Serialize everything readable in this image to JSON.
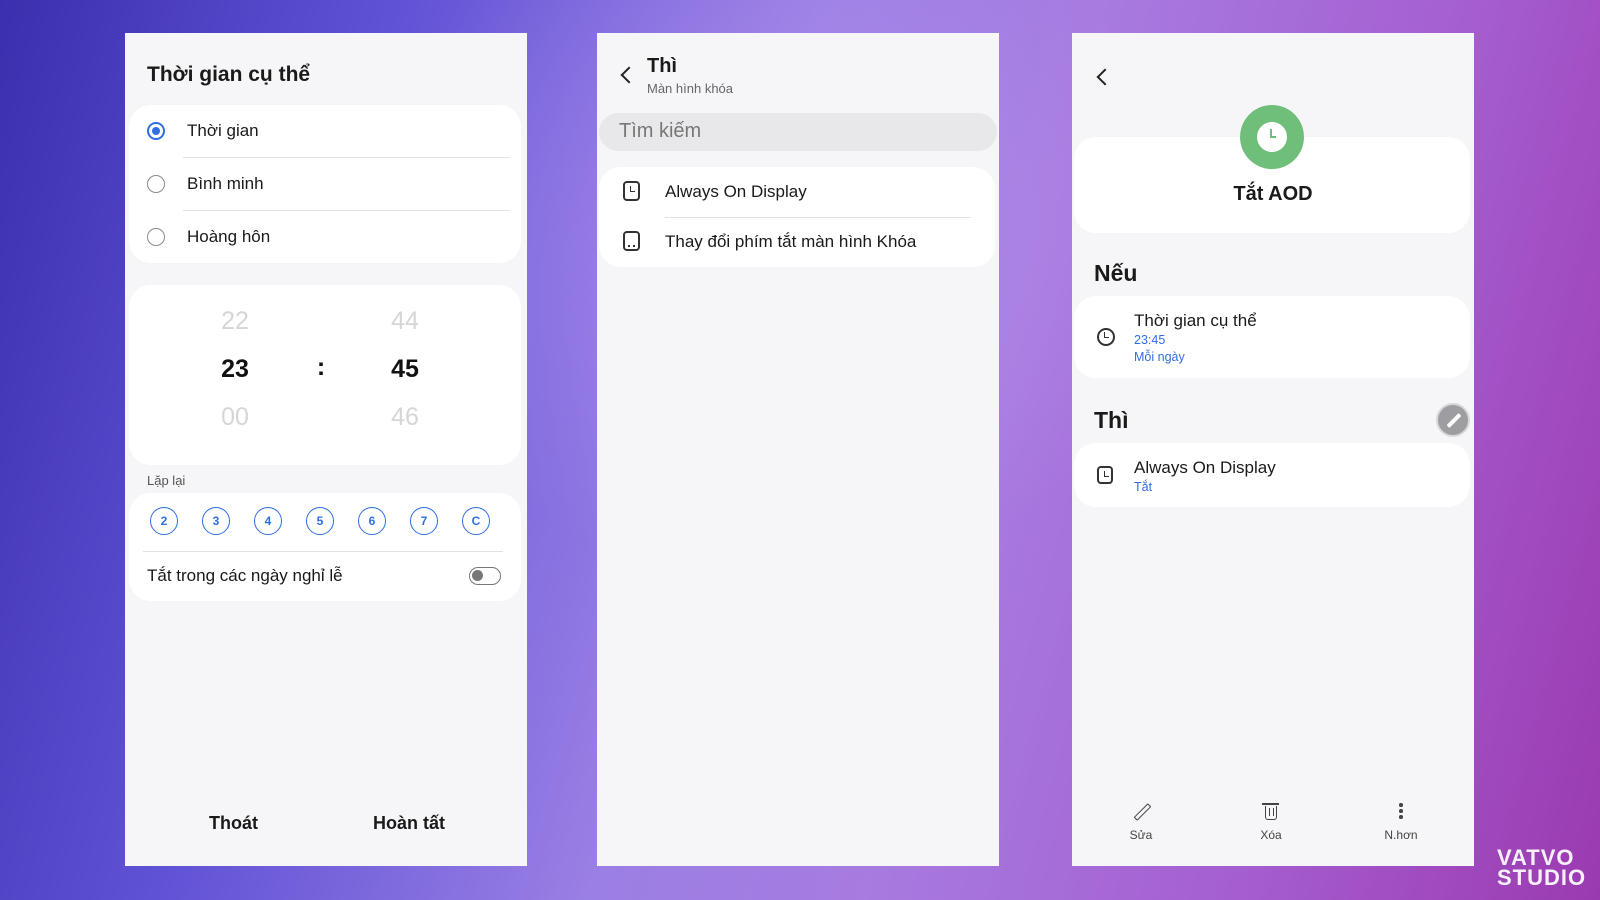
{
  "screen1": {
    "title": "Thời gian cụ thể",
    "radio_options": [
      {
        "label": "Thời gian",
        "selected": true
      },
      {
        "label": "Bình minh",
        "selected": false
      },
      {
        "label": "Hoàng hôn",
        "selected": false
      }
    ],
    "picker": {
      "hours": {
        "prev": "22",
        "current": "23",
        "next": "00"
      },
      "separator": ":",
      "minutes": {
        "prev": "44",
        "current": "45",
        "next": "46"
      }
    },
    "repeat_label": "Lặp lại",
    "days": [
      "2",
      "3",
      "4",
      "5",
      "6",
      "7",
      "C"
    ],
    "holiday_label": "Tắt trong các ngày nghỉ lễ",
    "holiday_toggle_on": false,
    "cancel_label": "Thoát",
    "done_label": "Hoàn tất"
  },
  "screen2": {
    "title": "Thì",
    "subtitle": "Màn hình khóa",
    "search_placeholder": "Tìm kiếm",
    "items": [
      {
        "label": "Always On Display",
        "icon": "aod-icon"
      },
      {
        "label": "Thay đổi phím tắt màn hình Khóa",
        "icon": "lockscreen-shortcut-icon"
      }
    ]
  },
  "screen3": {
    "routine_name": "Tắt AOD",
    "if_header": "Nếu",
    "condition": {
      "title": "Thời gian cụ thể",
      "time": "23:45",
      "repeat": "Mỗi ngày"
    },
    "then_header": "Thì",
    "action": {
      "title": "Always On Display",
      "value": "Tắt"
    },
    "nav": {
      "edit_label": "Sửa",
      "delete_label": "Xóa",
      "more_label": "N.hơn"
    },
    "accent_color": "#6fbf7a"
  },
  "watermark": {
    "line1": "VATVO",
    "line2": "STUDIO"
  },
  "colors": {
    "accent_blue": "#2f6fe0",
    "screen_bg": "#f6f6f8"
  }
}
